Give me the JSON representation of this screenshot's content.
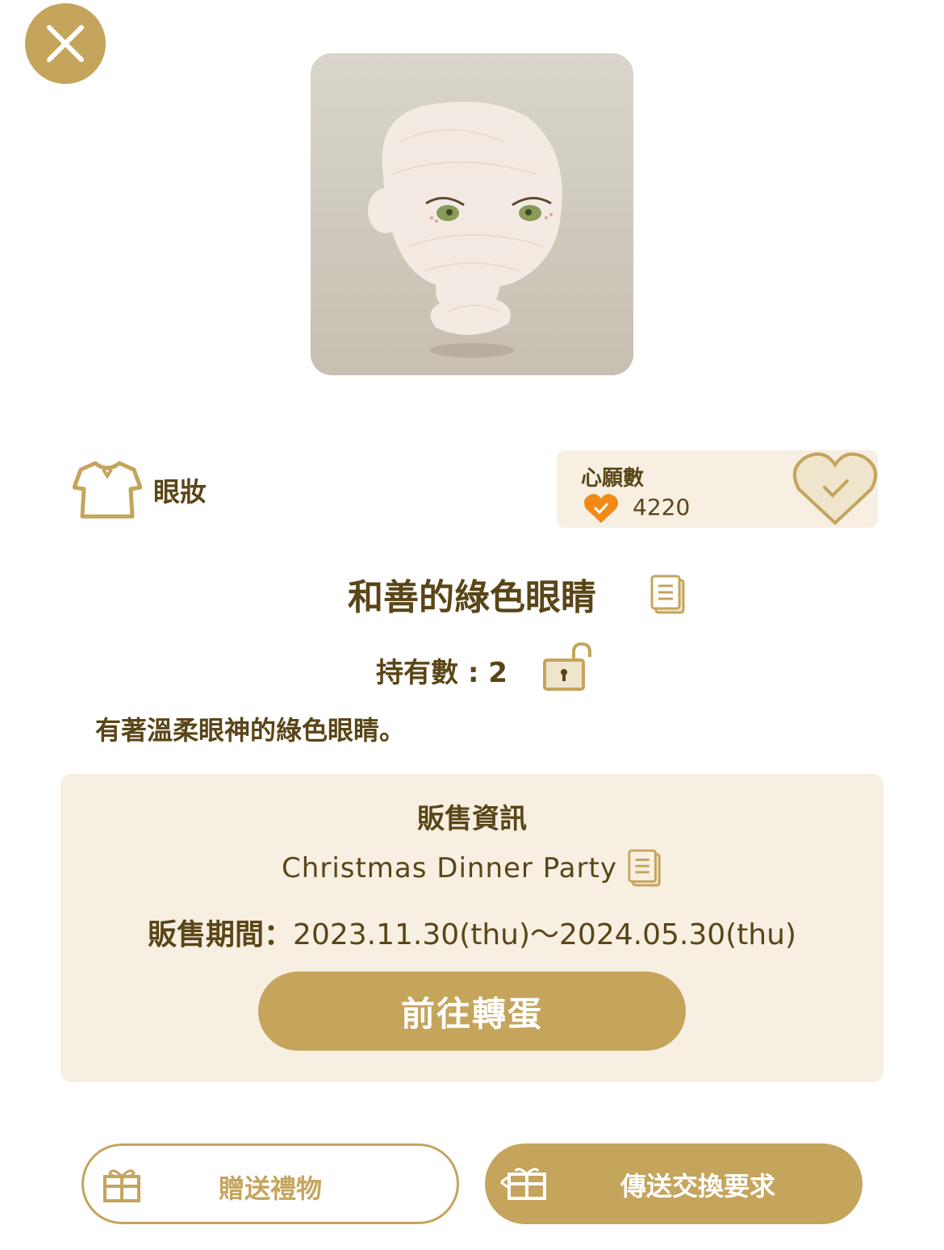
{
  "header": {
    "close_icon": "close-icon"
  },
  "item": {
    "category": "眼妝",
    "category_icon": "shirt-icon",
    "name": "和善的綠色眼睛",
    "owned_label": "持有數 : 2",
    "description": "有著溫柔眼神的綠色眼睛。"
  },
  "wishlist": {
    "label": "心願數",
    "count": "4220"
  },
  "sale_info": {
    "title": "販售資訊",
    "event_name": "Christmas Dinner Party",
    "period_label": "販售期間：",
    "period_value": "2023.11.30(thu)～2024.05.30(thu)",
    "goto_button": "前往轉蛋"
  },
  "actions": {
    "gift_button": "贈送禮物",
    "trade_button": "傳送交換要求"
  },
  "colors": {
    "accent": "#c5a45c",
    "text": "#5a4517",
    "panel": "#f6efe2",
    "heart": "#f08a16"
  }
}
